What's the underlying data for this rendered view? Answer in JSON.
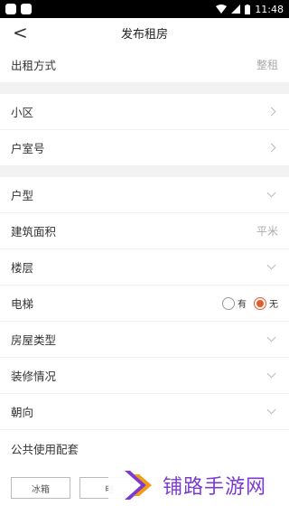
{
  "status": {
    "time": "11:48"
  },
  "nav": {
    "title": "发布租房",
    "back_glyph": "<"
  },
  "rent_mode": {
    "label": "出租方式",
    "value": "整租"
  },
  "community": {
    "label": "小区"
  },
  "room_no": {
    "label": "户室号"
  },
  "layout": {
    "label": "户型"
  },
  "area": {
    "label": "建筑面积",
    "placeholder": "平米"
  },
  "floor": {
    "label": "楼层"
  },
  "elevator": {
    "label": "电梯",
    "options": [
      "有",
      "无"
    ],
    "selected": "无"
  },
  "house_type": {
    "label": "房屋类型"
  },
  "decoration": {
    "label": "装修情况"
  },
  "orientation": {
    "label": "朝向"
  },
  "amenities": {
    "label": "公共使用配套",
    "items": [
      "冰箱",
      "电"
    ]
  },
  "watermark": {
    "text": "铺路手游网"
  },
  "colors": {
    "accent": "#e85a2c",
    "watermark": "#7b3bd1"
  }
}
